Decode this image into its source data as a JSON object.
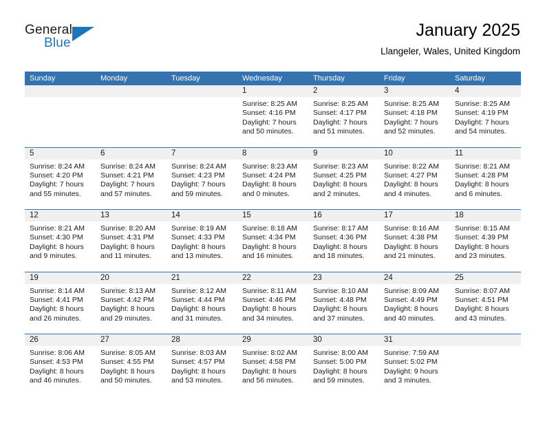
{
  "brand": {
    "name_part1": "General",
    "name_part2": "Blue",
    "accent_color": "#1b75bb"
  },
  "header": {
    "title": "January 2025",
    "subtitle": "Llangeler, Wales, United Kingdom",
    "header_bg_color": "#3572b0",
    "date_strip_color": "#f0f0f0"
  },
  "weekdays": [
    "Sunday",
    "Monday",
    "Tuesday",
    "Wednesday",
    "Thursday",
    "Friday",
    "Saturday"
  ],
  "weeks": [
    [
      {
        "date": "",
        "sunrise": "",
        "sunset": "",
        "daylight_line1": "",
        "daylight_line2": "",
        "empty": true
      },
      {
        "date": "",
        "sunrise": "",
        "sunset": "",
        "daylight_line1": "",
        "daylight_line2": "",
        "empty": true
      },
      {
        "date": "",
        "sunrise": "",
        "sunset": "",
        "daylight_line1": "",
        "daylight_line2": "",
        "empty": true
      },
      {
        "date": "1",
        "sunrise": "Sunrise: 8:25 AM",
        "sunset": "Sunset: 4:16 PM",
        "daylight_line1": "Daylight: 7 hours",
        "daylight_line2": "and 50 minutes."
      },
      {
        "date": "2",
        "sunrise": "Sunrise: 8:25 AM",
        "sunset": "Sunset: 4:17 PM",
        "daylight_line1": "Daylight: 7 hours",
        "daylight_line2": "and 51 minutes."
      },
      {
        "date": "3",
        "sunrise": "Sunrise: 8:25 AM",
        "sunset": "Sunset: 4:18 PM",
        "daylight_line1": "Daylight: 7 hours",
        "daylight_line2": "and 52 minutes."
      },
      {
        "date": "4",
        "sunrise": "Sunrise: 8:25 AM",
        "sunset": "Sunset: 4:19 PM",
        "daylight_line1": "Daylight: 7 hours",
        "daylight_line2": "and 54 minutes."
      }
    ],
    [
      {
        "date": "5",
        "sunrise": "Sunrise: 8:24 AM",
        "sunset": "Sunset: 4:20 PM",
        "daylight_line1": "Daylight: 7 hours",
        "daylight_line2": "and 55 minutes."
      },
      {
        "date": "6",
        "sunrise": "Sunrise: 8:24 AM",
        "sunset": "Sunset: 4:21 PM",
        "daylight_line1": "Daylight: 7 hours",
        "daylight_line2": "and 57 minutes."
      },
      {
        "date": "7",
        "sunrise": "Sunrise: 8:24 AM",
        "sunset": "Sunset: 4:23 PM",
        "daylight_line1": "Daylight: 7 hours",
        "daylight_line2": "and 59 minutes."
      },
      {
        "date": "8",
        "sunrise": "Sunrise: 8:23 AM",
        "sunset": "Sunset: 4:24 PM",
        "daylight_line1": "Daylight: 8 hours",
        "daylight_line2": "and 0 minutes."
      },
      {
        "date": "9",
        "sunrise": "Sunrise: 8:23 AM",
        "sunset": "Sunset: 4:25 PM",
        "daylight_line1": "Daylight: 8 hours",
        "daylight_line2": "and 2 minutes."
      },
      {
        "date": "10",
        "sunrise": "Sunrise: 8:22 AM",
        "sunset": "Sunset: 4:27 PM",
        "daylight_line1": "Daylight: 8 hours",
        "daylight_line2": "and 4 minutes."
      },
      {
        "date": "11",
        "sunrise": "Sunrise: 8:21 AM",
        "sunset": "Sunset: 4:28 PM",
        "daylight_line1": "Daylight: 8 hours",
        "daylight_line2": "and 6 minutes."
      }
    ],
    [
      {
        "date": "12",
        "sunrise": "Sunrise: 8:21 AM",
        "sunset": "Sunset: 4:30 PM",
        "daylight_line1": "Daylight: 8 hours",
        "daylight_line2": "and 9 minutes."
      },
      {
        "date": "13",
        "sunrise": "Sunrise: 8:20 AM",
        "sunset": "Sunset: 4:31 PM",
        "daylight_line1": "Daylight: 8 hours",
        "daylight_line2": "and 11 minutes."
      },
      {
        "date": "14",
        "sunrise": "Sunrise: 8:19 AM",
        "sunset": "Sunset: 4:33 PM",
        "daylight_line1": "Daylight: 8 hours",
        "daylight_line2": "and 13 minutes."
      },
      {
        "date": "15",
        "sunrise": "Sunrise: 8:18 AM",
        "sunset": "Sunset: 4:34 PM",
        "daylight_line1": "Daylight: 8 hours",
        "daylight_line2": "and 16 minutes."
      },
      {
        "date": "16",
        "sunrise": "Sunrise: 8:17 AM",
        "sunset": "Sunset: 4:36 PM",
        "daylight_line1": "Daylight: 8 hours",
        "daylight_line2": "and 18 minutes."
      },
      {
        "date": "17",
        "sunrise": "Sunrise: 8:16 AM",
        "sunset": "Sunset: 4:38 PM",
        "daylight_line1": "Daylight: 8 hours",
        "daylight_line2": "and 21 minutes."
      },
      {
        "date": "18",
        "sunrise": "Sunrise: 8:15 AM",
        "sunset": "Sunset: 4:39 PM",
        "daylight_line1": "Daylight: 8 hours",
        "daylight_line2": "and 23 minutes."
      }
    ],
    [
      {
        "date": "19",
        "sunrise": "Sunrise: 8:14 AM",
        "sunset": "Sunset: 4:41 PM",
        "daylight_line1": "Daylight: 8 hours",
        "daylight_line2": "and 26 minutes."
      },
      {
        "date": "20",
        "sunrise": "Sunrise: 8:13 AM",
        "sunset": "Sunset: 4:42 PM",
        "daylight_line1": "Daylight: 8 hours",
        "daylight_line2": "and 29 minutes."
      },
      {
        "date": "21",
        "sunrise": "Sunrise: 8:12 AM",
        "sunset": "Sunset: 4:44 PM",
        "daylight_line1": "Daylight: 8 hours",
        "daylight_line2": "and 31 minutes."
      },
      {
        "date": "22",
        "sunrise": "Sunrise: 8:11 AM",
        "sunset": "Sunset: 4:46 PM",
        "daylight_line1": "Daylight: 8 hours",
        "daylight_line2": "and 34 minutes."
      },
      {
        "date": "23",
        "sunrise": "Sunrise: 8:10 AM",
        "sunset": "Sunset: 4:48 PM",
        "daylight_line1": "Daylight: 8 hours",
        "daylight_line2": "and 37 minutes."
      },
      {
        "date": "24",
        "sunrise": "Sunrise: 8:09 AM",
        "sunset": "Sunset: 4:49 PM",
        "daylight_line1": "Daylight: 8 hours",
        "daylight_line2": "and 40 minutes."
      },
      {
        "date": "25",
        "sunrise": "Sunrise: 8:07 AM",
        "sunset": "Sunset: 4:51 PM",
        "daylight_line1": "Daylight: 8 hours",
        "daylight_line2": "and 43 minutes."
      }
    ],
    [
      {
        "date": "26",
        "sunrise": "Sunrise: 8:06 AM",
        "sunset": "Sunset: 4:53 PM",
        "daylight_line1": "Daylight: 8 hours",
        "daylight_line2": "and 46 minutes."
      },
      {
        "date": "27",
        "sunrise": "Sunrise: 8:05 AM",
        "sunset": "Sunset: 4:55 PM",
        "daylight_line1": "Daylight: 8 hours",
        "daylight_line2": "and 50 minutes."
      },
      {
        "date": "28",
        "sunrise": "Sunrise: 8:03 AM",
        "sunset": "Sunset: 4:57 PM",
        "daylight_line1": "Daylight: 8 hours",
        "daylight_line2": "and 53 minutes."
      },
      {
        "date": "29",
        "sunrise": "Sunrise: 8:02 AM",
        "sunset": "Sunset: 4:58 PM",
        "daylight_line1": "Daylight: 8 hours",
        "daylight_line2": "and 56 minutes."
      },
      {
        "date": "30",
        "sunrise": "Sunrise: 8:00 AM",
        "sunset": "Sunset: 5:00 PM",
        "daylight_line1": "Daylight: 8 hours",
        "daylight_line2": "and 59 minutes."
      },
      {
        "date": "31",
        "sunrise": "Sunrise: 7:59 AM",
        "sunset": "Sunset: 5:02 PM",
        "daylight_line1": "Daylight: 9 hours",
        "daylight_line2": "and 3 minutes."
      },
      {
        "date": "",
        "sunrise": "",
        "sunset": "",
        "daylight_line1": "",
        "daylight_line2": "",
        "empty": true
      }
    ]
  ]
}
